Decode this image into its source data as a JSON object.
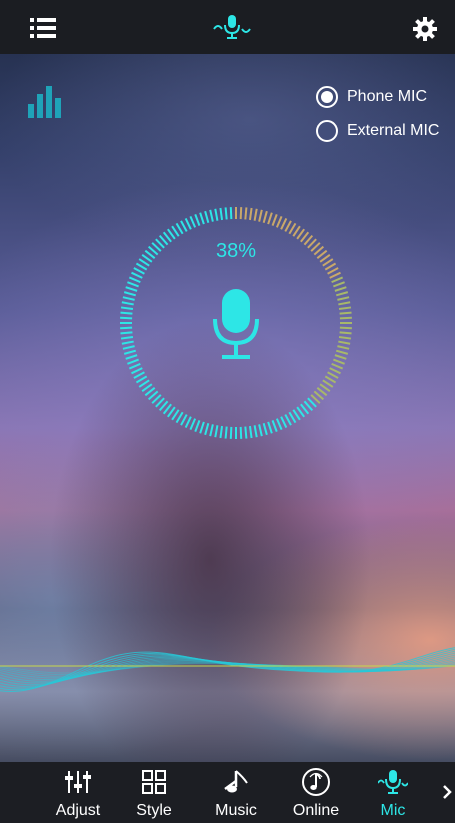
{
  "colors": {
    "accent": "#2de6e6",
    "topbar_bg": "#1b1d22",
    "nav_bg": "#1c1e23"
  },
  "topbar": {
    "menu_icon": "list-menu-icon",
    "logo_icon": "mic-wave-logo-icon",
    "settings_icon": "gear-icon"
  },
  "equalizer_icon": "equalizer-bars-icon",
  "mic_source": {
    "options": [
      {
        "label": "Phone MIC",
        "selected": true
      },
      {
        "label": "External MIC",
        "selected": false
      }
    ]
  },
  "gauge": {
    "percent_text": "38%",
    "level": 0.38
  },
  "nav": {
    "items": [
      {
        "label": "Adjust",
        "icon": "sliders-icon",
        "active": false
      },
      {
        "label": "Style",
        "icon": "grid-icon",
        "active": false
      },
      {
        "label": "Music",
        "icon": "music-note-icon",
        "active": false
      },
      {
        "label": "Online",
        "icon": "online-music-icon",
        "active": false
      },
      {
        "label": "Mic",
        "icon": "mic-wave-icon",
        "active": true
      }
    ],
    "next_icon": "chevron-right-icon"
  }
}
